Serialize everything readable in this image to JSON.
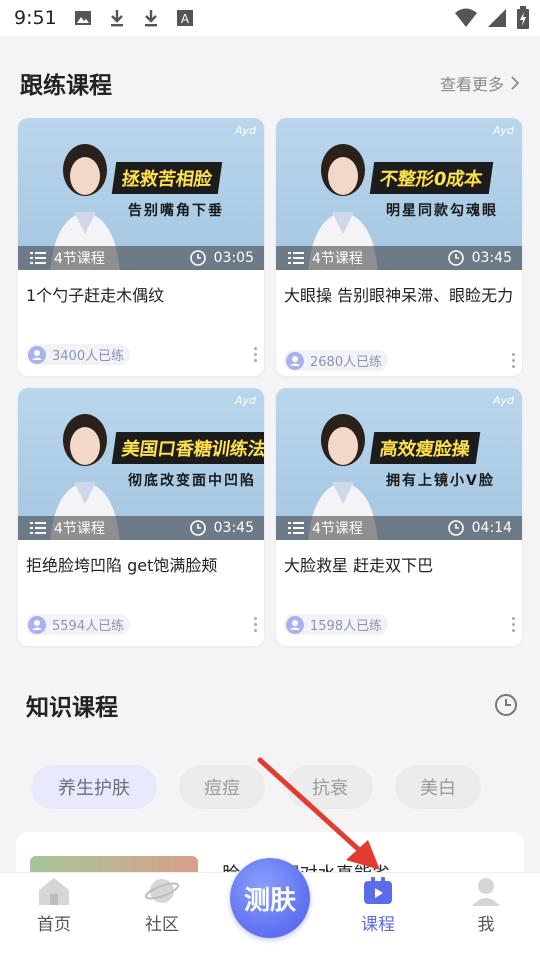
{
  "status_bar": {
    "time": "9:51"
  },
  "follow": {
    "title": "跟练课程",
    "see_more": "查看更多",
    "cards": [
      {
        "banner1": "拯救苦相脸",
        "banner2": "告别嘴角下垂",
        "brand": "Ayd",
        "lessons": "4节课程",
        "duration": "03:05",
        "title": "1个勺子赶走木偶纹",
        "learners": "3400人已练"
      },
      {
        "banner1": "不整形0成本",
        "banner2": "明星同款勾魂眼",
        "brand": "Ayd",
        "lessons": "4节课程",
        "duration": "03:45",
        "title": "大眼操 告别眼神呆滞、眼睑无力",
        "learners": "2680人已练"
      },
      {
        "banner1": "美国口香糖训练法",
        "banner2": "彻底改变面中凹陷",
        "brand": "Ayd",
        "lessons": "4节课程",
        "duration": "03:45",
        "title": "拒绝脸垮凹陷  get饱满脸颊",
        "learners": "5594人已练"
      },
      {
        "banner1": "高效瘦脸操",
        "banner2": "拥有上镜小V脸",
        "brand": "Ayd",
        "lessons": "4节课程",
        "duration": "04:14",
        "title": "大脸救星 赶走双下巴",
        "learners": "1598人已练"
      }
    ]
  },
  "knowledge": {
    "title": "知识课程",
    "chips": [
      "养生护肤",
      "痘痘",
      "抗衰",
      "美白"
    ],
    "active_chip": "养生护肤",
    "peek_title": "脸 没到喝对水真能省"
  },
  "bottom_nav": {
    "items": [
      "首页",
      "社区",
      "课程",
      "我"
    ],
    "center": "测肤",
    "active": "课程"
  },
  "colors": {
    "accent": "#5b6bea",
    "arrow": "#e23b30"
  }
}
